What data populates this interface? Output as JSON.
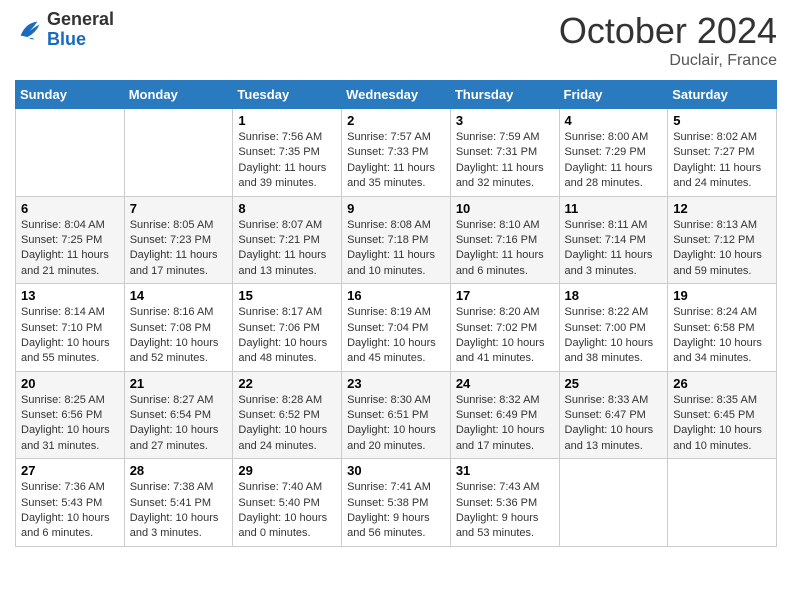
{
  "header": {
    "logo_general": "General",
    "logo_blue": "Blue",
    "month_title": "October 2024",
    "location": "Duclair, France"
  },
  "days_of_week": [
    "Sunday",
    "Monday",
    "Tuesday",
    "Wednesday",
    "Thursday",
    "Friday",
    "Saturday"
  ],
  "weeks": [
    [
      {
        "day": "",
        "info": ""
      },
      {
        "day": "",
        "info": ""
      },
      {
        "day": "1",
        "sunrise": "Sunrise: 7:56 AM",
        "sunset": "Sunset: 7:35 PM",
        "daylight": "Daylight: 11 hours and 39 minutes."
      },
      {
        "day": "2",
        "sunrise": "Sunrise: 7:57 AM",
        "sunset": "Sunset: 7:33 PM",
        "daylight": "Daylight: 11 hours and 35 minutes."
      },
      {
        "day": "3",
        "sunrise": "Sunrise: 7:59 AM",
        "sunset": "Sunset: 7:31 PM",
        "daylight": "Daylight: 11 hours and 32 minutes."
      },
      {
        "day": "4",
        "sunrise": "Sunrise: 8:00 AM",
        "sunset": "Sunset: 7:29 PM",
        "daylight": "Daylight: 11 hours and 28 minutes."
      },
      {
        "day": "5",
        "sunrise": "Sunrise: 8:02 AM",
        "sunset": "Sunset: 7:27 PM",
        "daylight": "Daylight: 11 hours and 24 minutes."
      }
    ],
    [
      {
        "day": "6",
        "sunrise": "Sunrise: 8:04 AM",
        "sunset": "Sunset: 7:25 PM",
        "daylight": "Daylight: 11 hours and 21 minutes."
      },
      {
        "day": "7",
        "sunrise": "Sunrise: 8:05 AM",
        "sunset": "Sunset: 7:23 PM",
        "daylight": "Daylight: 11 hours and 17 minutes."
      },
      {
        "day": "8",
        "sunrise": "Sunrise: 8:07 AM",
        "sunset": "Sunset: 7:21 PM",
        "daylight": "Daylight: 11 hours and 13 minutes."
      },
      {
        "day": "9",
        "sunrise": "Sunrise: 8:08 AM",
        "sunset": "Sunset: 7:18 PM",
        "daylight": "Daylight: 11 hours and 10 minutes."
      },
      {
        "day": "10",
        "sunrise": "Sunrise: 8:10 AM",
        "sunset": "Sunset: 7:16 PM",
        "daylight": "Daylight: 11 hours and 6 minutes."
      },
      {
        "day": "11",
        "sunrise": "Sunrise: 8:11 AM",
        "sunset": "Sunset: 7:14 PM",
        "daylight": "Daylight: 11 hours and 3 minutes."
      },
      {
        "day": "12",
        "sunrise": "Sunrise: 8:13 AM",
        "sunset": "Sunset: 7:12 PM",
        "daylight": "Daylight: 10 hours and 59 minutes."
      }
    ],
    [
      {
        "day": "13",
        "sunrise": "Sunrise: 8:14 AM",
        "sunset": "Sunset: 7:10 PM",
        "daylight": "Daylight: 10 hours and 55 minutes."
      },
      {
        "day": "14",
        "sunrise": "Sunrise: 8:16 AM",
        "sunset": "Sunset: 7:08 PM",
        "daylight": "Daylight: 10 hours and 52 minutes."
      },
      {
        "day": "15",
        "sunrise": "Sunrise: 8:17 AM",
        "sunset": "Sunset: 7:06 PM",
        "daylight": "Daylight: 10 hours and 48 minutes."
      },
      {
        "day": "16",
        "sunrise": "Sunrise: 8:19 AM",
        "sunset": "Sunset: 7:04 PM",
        "daylight": "Daylight: 10 hours and 45 minutes."
      },
      {
        "day": "17",
        "sunrise": "Sunrise: 8:20 AM",
        "sunset": "Sunset: 7:02 PM",
        "daylight": "Daylight: 10 hours and 41 minutes."
      },
      {
        "day": "18",
        "sunrise": "Sunrise: 8:22 AM",
        "sunset": "Sunset: 7:00 PM",
        "daylight": "Daylight: 10 hours and 38 minutes."
      },
      {
        "day": "19",
        "sunrise": "Sunrise: 8:24 AM",
        "sunset": "Sunset: 6:58 PM",
        "daylight": "Daylight: 10 hours and 34 minutes."
      }
    ],
    [
      {
        "day": "20",
        "sunrise": "Sunrise: 8:25 AM",
        "sunset": "Sunset: 6:56 PM",
        "daylight": "Daylight: 10 hours and 31 minutes."
      },
      {
        "day": "21",
        "sunrise": "Sunrise: 8:27 AM",
        "sunset": "Sunset: 6:54 PM",
        "daylight": "Daylight: 10 hours and 27 minutes."
      },
      {
        "day": "22",
        "sunrise": "Sunrise: 8:28 AM",
        "sunset": "Sunset: 6:52 PM",
        "daylight": "Daylight: 10 hours and 24 minutes."
      },
      {
        "day": "23",
        "sunrise": "Sunrise: 8:30 AM",
        "sunset": "Sunset: 6:51 PM",
        "daylight": "Daylight: 10 hours and 20 minutes."
      },
      {
        "day": "24",
        "sunrise": "Sunrise: 8:32 AM",
        "sunset": "Sunset: 6:49 PM",
        "daylight": "Daylight: 10 hours and 17 minutes."
      },
      {
        "day": "25",
        "sunrise": "Sunrise: 8:33 AM",
        "sunset": "Sunset: 6:47 PM",
        "daylight": "Daylight: 10 hours and 13 minutes."
      },
      {
        "day": "26",
        "sunrise": "Sunrise: 8:35 AM",
        "sunset": "Sunset: 6:45 PM",
        "daylight": "Daylight: 10 hours and 10 minutes."
      }
    ],
    [
      {
        "day": "27",
        "sunrise": "Sunrise: 7:36 AM",
        "sunset": "Sunset: 5:43 PM",
        "daylight": "Daylight: 10 hours and 6 minutes."
      },
      {
        "day": "28",
        "sunrise": "Sunrise: 7:38 AM",
        "sunset": "Sunset: 5:41 PM",
        "daylight": "Daylight: 10 hours and 3 minutes."
      },
      {
        "day": "29",
        "sunrise": "Sunrise: 7:40 AM",
        "sunset": "Sunset: 5:40 PM",
        "daylight": "Daylight: 10 hours and 0 minutes."
      },
      {
        "day": "30",
        "sunrise": "Sunrise: 7:41 AM",
        "sunset": "Sunset: 5:38 PM",
        "daylight": "Daylight: 9 hours and 56 minutes."
      },
      {
        "day": "31",
        "sunrise": "Sunrise: 7:43 AM",
        "sunset": "Sunset: 5:36 PM",
        "daylight": "Daylight: 9 hours and 53 minutes."
      },
      {
        "day": "",
        "info": ""
      },
      {
        "day": "",
        "info": ""
      }
    ]
  ]
}
